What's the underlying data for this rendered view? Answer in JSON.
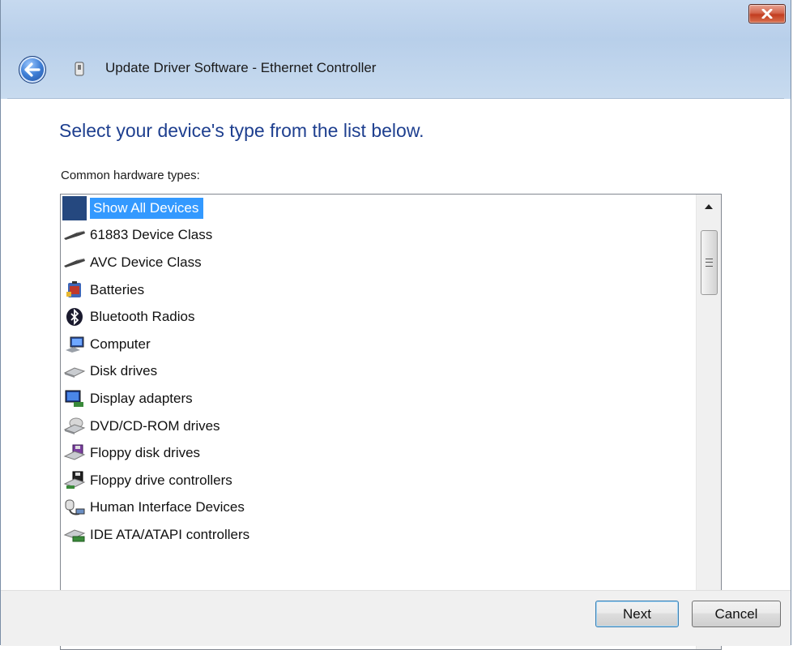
{
  "window": {
    "title": "Update Driver Software - Ethernet Controller"
  },
  "content": {
    "heading": "Select your device's type from the list below.",
    "list_caption": "Common hardware types:",
    "items": [
      {
        "label": "Show All Devices",
        "icon": "show-all-icon",
        "selected": true
      },
      {
        "label": "61883 Device Class",
        "icon": "cable-icon"
      },
      {
        "label": "AVC Device Class",
        "icon": "cable-icon"
      },
      {
        "label": "Batteries",
        "icon": "battery-icon"
      },
      {
        "label": "Bluetooth Radios",
        "icon": "bluetooth-icon"
      },
      {
        "label": "Computer",
        "icon": "computer-icon"
      },
      {
        "label": "Disk drives",
        "icon": "disk-drive-icon"
      },
      {
        "label": "Display adapters",
        "icon": "display-adapter-icon"
      },
      {
        "label": "DVD/CD-ROM drives",
        "icon": "dvd-drive-icon"
      },
      {
        "label": "Floppy disk drives",
        "icon": "floppy-drive-icon"
      },
      {
        "label": "Floppy drive controllers",
        "icon": "floppy-controller-icon"
      },
      {
        "label": "Human Interface Devices",
        "icon": "hid-icon"
      },
      {
        "label": "IDE ATA/ATAPI controllers",
        "icon": "ide-controller-icon"
      }
    ]
  },
  "footer": {
    "next_label": "Next",
    "cancel_label": "Cancel"
  },
  "colors": {
    "heading": "#1e3f8f",
    "selection": "#3399ff",
    "close_button": "#c23d20"
  }
}
